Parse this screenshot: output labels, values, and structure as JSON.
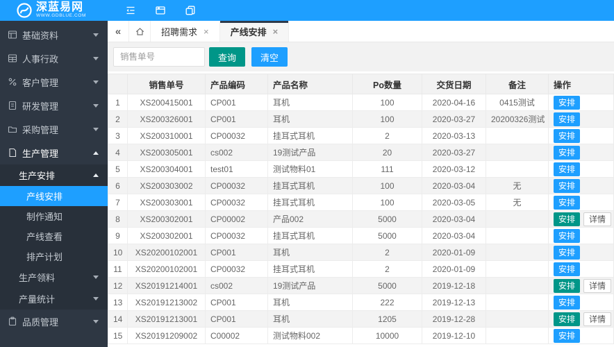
{
  "brand": {
    "name": "深蓝易网",
    "url": "WWW.GDBLUE.COM"
  },
  "colors": {
    "primary": "#1E9FFF",
    "teal": "#009688",
    "sidebar_bg": "#2E3743",
    "sidebar_child_bg": "#28303A",
    "active_tab_border": "#2D3A4B",
    "table_header_bg": "#F2F2F2",
    "row_stripe_bg": "#F3F3F3"
  },
  "topbar": {
    "icons": [
      "menu-fold-icon",
      "window-tabs-icon",
      "copy-icon"
    ]
  },
  "sidebar": {
    "items": [
      {
        "label": "基础资料",
        "icon": "base-data-icon",
        "state": "collapsed"
      },
      {
        "label": "人事行政",
        "icon": "hr-admin-icon",
        "state": "collapsed"
      },
      {
        "label": "客户管理",
        "icon": "customer-icon",
        "state": "collapsed"
      },
      {
        "label": "研发管理",
        "icon": "rd-icon",
        "state": "collapsed"
      },
      {
        "label": "采购管理",
        "icon": "purchase-icon",
        "state": "collapsed"
      },
      {
        "label": "生产管理",
        "icon": "production-icon",
        "state": "expanded",
        "children": [
          {
            "label": "生产安排",
            "state": "expanded",
            "children": [
              {
                "label": "产线安排",
                "active": true
              },
              {
                "label": "制作通知"
              },
              {
                "label": "产线查看"
              },
              {
                "label": "排产计划"
              }
            ]
          },
          {
            "label": "生产领料",
            "state": "collapsed"
          },
          {
            "label": "产量统计",
            "state": "collapsed"
          }
        ]
      },
      {
        "label": "品质管理",
        "icon": "quality-icon",
        "state": "collapsed"
      }
    ]
  },
  "tabbar": {
    "controls": [
      "collapse-tabs-icon",
      "home-icon"
    ],
    "tabs": [
      {
        "label": "招聘需求",
        "active": false,
        "closable": true
      },
      {
        "label": "产线安排",
        "active": true,
        "closable": true
      }
    ]
  },
  "toolbar": {
    "search_placeholder": "销售单号",
    "query_label": "查询",
    "clear_label": "清空"
  },
  "table": {
    "columns": [
      "",
      "销售单号",
      "产品编码",
      "产品名称",
      "Po数量",
      "交货日期",
      "备注",
      "操作"
    ],
    "action_labels": {
      "arrange": "安排",
      "detail": "详情"
    },
    "rows": [
      {
        "no": "1",
        "order_no": "XS200415001",
        "product_code": "CP001",
        "product_name": "耳机",
        "po_qty": "100",
        "delivery_date": "2020-04-16",
        "note": "0415测试",
        "arranged": false,
        "has_detail": false
      },
      {
        "no": "2",
        "order_no": "XS200326001",
        "product_code": "CP001",
        "product_name": "耳机",
        "po_qty": "100",
        "delivery_date": "2020-03-27",
        "note": "20200326测试",
        "arranged": false,
        "has_detail": false
      },
      {
        "no": "3",
        "order_no": "XS200310001",
        "product_code": "CP00032",
        "product_name": "挂耳式耳机",
        "po_qty": "2",
        "delivery_date": "2020-03-13",
        "note": "",
        "arranged": false,
        "has_detail": false
      },
      {
        "no": "4",
        "order_no": "XS200305001",
        "product_code": "cs002",
        "product_name": "19测试产品",
        "po_qty": "20",
        "delivery_date": "2020-03-27",
        "note": "",
        "arranged": false,
        "has_detail": false
      },
      {
        "no": "5",
        "order_no": "XS200304001",
        "product_code": "test01",
        "product_name": "测试物料01",
        "po_qty": "111",
        "delivery_date": "2020-03-12",
        "note": "",
        "arranged": false,
        "has_detail": false
      },
      {
        "no": "6",
        "order_no": "XS200303002",
        "product_code": "CP00032",
        "product_name": "挂耳式耳机",
        "po_qty": "100",
        "delivery_date": "2020-03-04",
        "note": "无",
        "arranged": false,
        "has_detail": false
      },
      {
        "no": "7",
        "order_no": "XS200303001",
        "product_code": "CP00032",
        "product_name": "挂耳式耳机",
        "po_qty": "100",
        "delivery_date": "2020-03-05",
        "note": "无",
        "arranged": false,
        "has_detail": false
      },
      {
        "no": "8",
        "order_no": "XS200302001",
        "product_code": "CP00002",
        "product_name": "产品002",
        "po_qty": "5000",
        "delivery_date": "2020-03-04",
        "note": "",
        "arranged": true,
        "has_detail": true
      },
      {
        "no": "9",
        "order_no": "XS200302001",
        "product_code": "CP00032",
        "product_name": "挂耳式耳机",
        "po_qty": "5000",
        "delivery_date": "2020-03-04",
        "note": "",
        "arranged": false,
        "has_detail": false
      },
      {
        "no": "10",
        "order_no": "XS20200102001",
        "product_code": "CP001",
        "product_name": "耳机",
        "po_qty": "2",
        "delivery_date": "2020-01-09",
        "note": "",
        "arranged": false,
        "has_detail": false
      },
      {
        "no": "11",
        "order_no": "XS20200102001",
        "product_code": "CP00032",
        "product_name": "挂耳式耳机",
        "po_qty": "2",
        "delivery_date": "2020-01-09",
        "note": "",
        "arranged": false,
        "has_detail": false
      },
      {
        "no": "12",
        "order_no": "XS20191214001",
        "product_code": "cs002",
        "product_name": "19测试产品",
        "po_qty": "5000",
        "delivery_date": "2019-12-18",
        "note": "",
        "arranged": true,
        "has_detail": true
      },
      {
        "no": "13",
        "order_no": "XS20191213002",
        "product_code": "CP001",
        "product_name": "耳机",
        "po_qty": "222",
        "delivery_date": "2019-12-13",
        "note": "",
        "arranged": false,
        "has_detail": false
      },
      {
        "no": "14",
        "order_no": "XS20191213001",
        "product_code": "CP001",
        "product_name": "耳机",
        "po_qty": "1205",
        "delivery_date": "2019-12-28",
        "note": "",
        "arranged": true,
        "has_detail": true
      },
      {
        "no": "15",
        "order_no": "XS20191209002",
        "product_code": "C00002",
        "product_name": "测试物料002",
        "po_qty": "10000",
        "delivery_date": "2019-12-10",
        "note": "",
        "arranged": false,
        "has_detail": false
      }
    ]
  }
}
